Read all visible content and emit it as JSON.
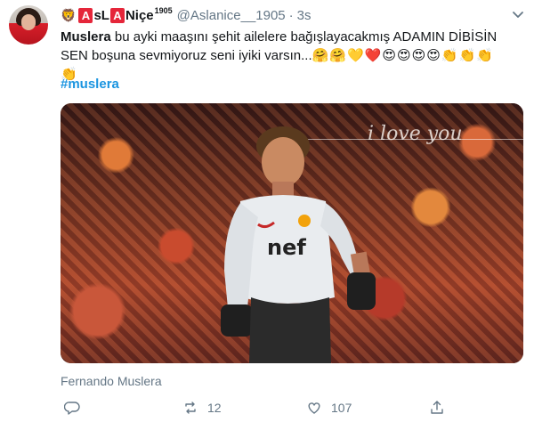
{
  "author": {
    "emoji": "🦁",
    "name_parts": [
      "A",
      "sL",
      "A",
      "Niçe"
    ],
    "name_sup": "1905",
    "handle": "@Aslanice__1905",
    "separator": "·",
    "time": "3s"
  },
  "tweet": {
    "bold_lead": "Muslera",
    "text_line1_rest": " bu ayki maaşını şehit ailelere bağışlayacakmış ADAMIN DİBİSİN",
    "text_line2": "SEN boşuna sevmiyoruz seni iyiki varsın...",
    "emojis_line2": "🤗🤗💛❤️😍😍😍😍👏👏👏",
    "emojis_line3": "👏",
    "hashtag": "#muslera"
  },
  "photo": {
    "overlay_text": "i love you"
  },
  "photo_caption": "Fernando Muslera",
  "actions": {
    "retweet_count": "12",
    "like_count": "107"
  },
  "icons": {
    "more": "chevron-down-icon",
    "reply": "reply-icon",
    "retweet": "retweet-icon",
    "like": "heart-icon",
    "share": "share-icon"
  },
  "colors": {
    "accent": "#1b95e0",
    "muted": "#657786",
    "name_box": "#e5263a"
  }
}
